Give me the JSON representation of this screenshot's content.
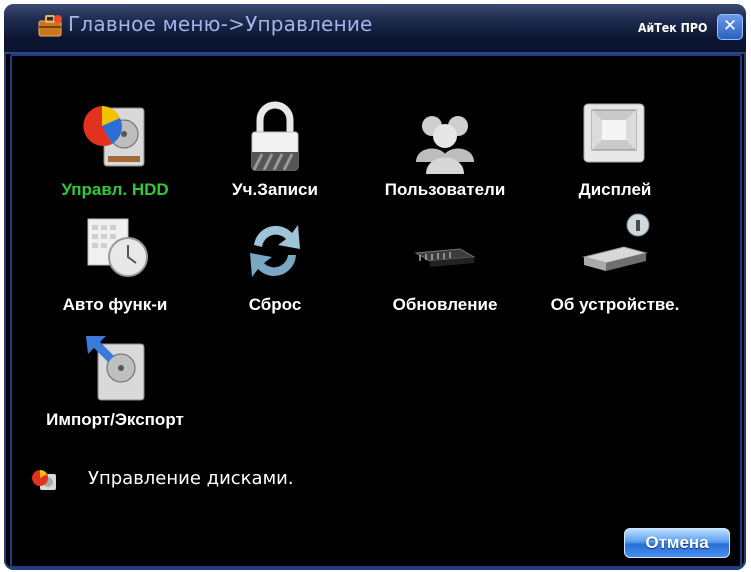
{
  "window": {
    "title": "Главное меню->Управление",
    "brand": "АйТек ПРО",
    "close_glyph": "✕"
  },
  "menu": {
    "items": [
      {
        "label": "Управл. HDD",
        "icon": "hdd-pie-icon",
        "selected": true
      },
      {
        "label": "Уч.Записи",
        "icon": "padlock-icon",
        "selected": false
      },
      {
        "label": "Пользователи",
        "icon": "users-icon",
        "selected": false
      },
      {
        "label": "Дисплей",
        "icon": "monitor-icon",
        "selected": false
      },
      {
        "label": "Авто функ-и",
        "icon": "calendar-clock-icon",
        "selected": false
      },
      {
        "label": "Сброс",
        "icon": "refresh-arrows-icon",
        "selected": false
      },
      {
        "label": "Обновление",
        "icon": "chip-icon",
        "selected": false
      },
      {
        "label": "Об устройстве.",
        "icon": "device-info-icon",
        "selected": false
      },
      {
        "label": "Импорт/Экспорт",
        "icon": "import-export-icon",
        "selected": false
      }
    ]
  },
  "status": {
    "text": "Управление дисками.",
    "icon": "hdd-small-icon"
  },
  "buttons": {
    "cancel": "Отмена"
  },
  "colors": {
    "selected_label": "#2ec83a",
    "label": "#ffffff",
    "title_text": "#9fb6e9",
    "frame_border": "#1c3d8a"
  }
}
